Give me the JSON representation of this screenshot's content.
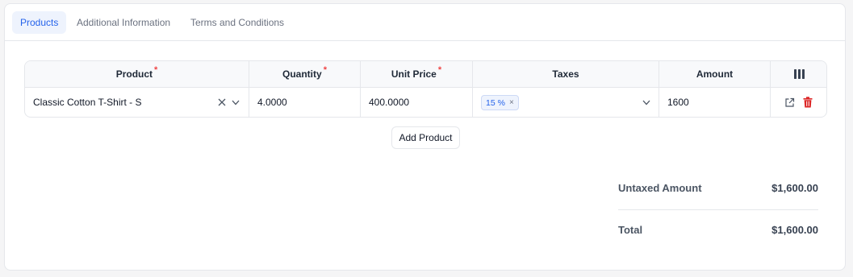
{
  "tabs": [
    {
      "label": "Products",
      "active": true
    },
    {
      "label": "Additional Information",
      "active": false
    },
    {
      "label": "Terms and Conditions",
      "active": false
    }
  ],
  "table": {
    "columns": [
      {
        "label": "Product",
        "required": true
      },
      {
        "label": "Quantity",
        "required": true
      },
      {
        "label": "Unit Price",
        "required": true
      },
      {
        "label": "Taxes",
        "required": false
      },
      {
        "label": "Amount",
        "required": false
      }
    ],
    "required_marker": "*",
    "rows": [
      {
        "product": "Classic Cotton T-Shirt - S",
        "quantity": "4.0000",
        "unit_price": "400.0000",
        "tax_tag": "15 %",
        "amount": "1600"
      }
    ]
  },
  "add_product_label": "Add Product",
  "summary": {
    "untaxed_label": "Untaxed Amount",
    "untaxed_value": "$1,600.00",
    "total_label": "Total",
    "total_value": "$1,600.00"
  },
  "colors": {
    "accent": "#2563eb",
    "required": "#ef4444",
    "delete": "#dc2626"
  },
  "icons": {
    "column_settings": "columns-icon",
    "clear": "clear-x-icon",
    "dropdown": "chevron-down-icon",
    "open": "external-link-icon",
    "delete": "trash-icon"
  }
}
